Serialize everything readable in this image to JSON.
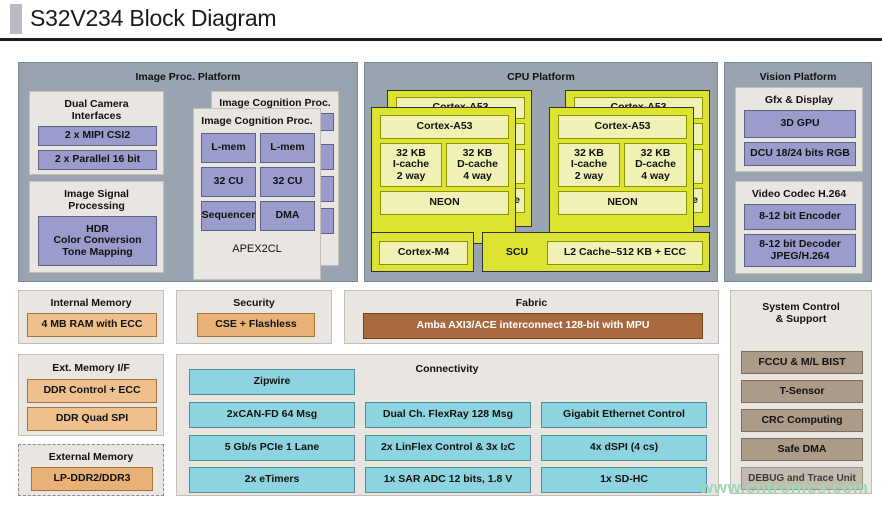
{
  "header": {
    "title": "S32V234 Block Diagram"
  },
  "watermark": "www.cntronics.com",
  "image_platform": {
    "title": "Image Proc. Platform",
    "camera": {
      "title_line1": "Dual Camera",
      "title_line2": "Interfaces",
      "items": [
        "2 x MIPI CSI2",
        "2 x Parallel 16 bit"
      ]
    },
    "isp": {
      "title_line1": "Image Signal",
      "title_line2": "Processing",
      "item": "HDR\nColor Conversion\nTone Mapping",
      "item_line1": "HDR",
      "item_line2": "Color Conversion",
      "item_line3": "Tone Mapping"
    },
    "apex": {
      "back_title": "Image Cognition Proc.",
      "front_title": "Image Cognition Proc.",
      "cells": [
        "L-mem",
        "L-mem",
        "32 CU",
        "32 CU",
        "Sequencer",
        "DMA"
      ],
      "footer": "APEX2CL"
    }
  },
  "cpu_platform": {
    "title": "CPU Platform",
    "core_back_label": "Cortex-A53",
    "core_front_label": "Cortex-A53",
    "icache_line1": "32 KB",
    "icache_line2": "I-cache",
    "icache_line3": "2 way",
    "dcache_line1": "32 KB",
    "dcache_line2": "D-cache",
    "dcache_line3": "4 way",
    "neon_label": "NEON",
    "cortex_m4": "Cortex-M4",
    "scu": "SCU",
    "l2_cache": "L2 Cache–512 KB + ECC"
  },
  "vision_platform": {
    "title": "Vision Platform",
    "gfx": {
      "title": "Gfx & Display",
      "items": [
        "3D GPU",
        "DCU 18/24 bits RGB"
      ]
    },
    "codec": {
      "title": "Video Codec H.264",
      "item1": "8-12 bit Encoder",
      "item2_line1": "8-12 bit Decoder",
      "item2_line2": "JPEG/H.264"
    }
  },
  "internal_memory": {
    "title": "Internal Memory",
    "item": "4 MB RAM with ECC"
  },
  "security": {
    "title": "Security",
    "item": "CSE + Flashless"
  },
  "fabric": {
    "title": "Fabric",
    "item": "Amba AXI3/ACE interconnect 128-bit with MPU"
  },
  "system_control": {
    "title_line1": "System Control",
    "title_line2": "& Support",
    "items": [
      "FCCU & M/L BIST",
      "T-Sensor",
      "CRC Computing",
      "Safe DMA",
      "DEBUG and Trace Unit"
    ]
  },
  "ext_memory_if": {
    "title": "Ext. Memory I/F",
    "items": [
      "DDR Control + ECC",
      "DDR Quad SPI"
    ]
  },
  "external_memory": {
    "title": "External Memory",
    "item": "LP-DDR2/DDR3"
  },
  "connectivity": {
    "title": "Connectivity",
    "zipwire": "Zipwire",
    "col1": [
      "2xCAN-FD 64 Msg",
      "5 Gb/s PCIe 1 Lane",
      "2x eTimers"
    ],
    "col2_row1": "Dual Ch. FlexRay 128 Msg",
    "col2_row2_pre": "2x LinFlex Control & 3x I",
    "col2_row2_sup": "2",
    "col2_row2_post": "C",
    "col2_row3": "1x SAR ADC 12 bits, 1.8 V",
    "col3": [
      "Gigabit Ethernet Control",
      "4x dSPI (4 cs)",
      "1x SD-HC"
    ]
  },
  "colors": {
    "panel_gray": "#9aa4b0",
    "card_bg": "#e9e6e1",
    "purple": "#9a9ccc",
    "yellow": "#dde331",
    "yellow_pale": "#eff2b4",
    "orange": "#e8b276",
    "brown": "#a9693f",
    "tan": "#ab9b88",
    "teal": "#8ed4e0",
    "watermark": "#9ed8b9"
  }
}
